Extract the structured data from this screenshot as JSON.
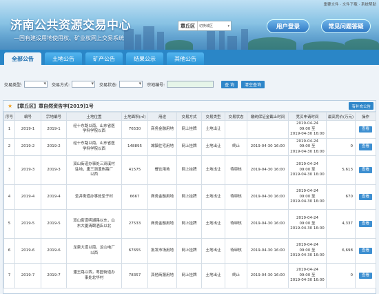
{
  "top_links": "重要文件 · 文件下载 · 系统帮助",
  "banner": {
    "title": "济南公共资源交易中心",
    "subtitle": "—国有建设用地使用权、矿业权网上交易系统",
    "region_label": "章丘区",
    "region_select": "切换城区",
    "login_label": "用户登录",
    "faq_label": "常见问题答疑"
  },
  "nav": {
    "tabs": [
      {
        "label": "全部公告",
        "active": true
      },
      {
        "label": "土地公告",
        "active": false
      },
      {
        "label": "矿产公告",
        "active": false
      },
      {
        "label": "结果公示",
        "active": false
      },
      {
        "label": "其他公告",
        "active": false
      }
    ]
  },
  "filter": {
    "type_label": "交易类型:",
    "method_label": "交易方式:",
    "status_label": "交易状态:",
    "parcel_label": "宗地编号:",
    "search_label": "查 询",
    "reset_label": "清空查询"
  },
  "panel": {
    "title": "【章丘区】章自然资告字[2019]1号",
    "supplement_label": "有补充公告"
  },
  "table": {
    "headers": [
      "序号",
      "编号",
      "宗地编号",
      "土地位置",
      "土地面积(㎡)",
      "用途",
      "交易方式",
      "交易类型",
      "交易状态",
      "缴纳保证金截止时间",
      "竞买申请时间",
      "最高竞价(万元)",
      "操作"
    ],
    "rows": [
      {
        "no": "1",
        "code": "2019-1",
        "parcel": "2019-1",
        "location": [
          "经十东路以南，山东省医",
          "学科学院以西"
        ],
        "area": "76530",
        "use": "商务金融用地",
        "method": "网上挂牌",
        "type": "土地出让",
        "status": "",
        "deadline": "",
        "apply": [
          "2019-04-24",
          "09:00 至",
          "2019-04-30 16:00"
        ],
        "price": "",
        "op": "查看"
      },
      {
        "no": "2",
        "code": "2019-2",
        "parcel": "2019-2",
        "location": [
          "经十东路以南，山东省医",
          "学科学院以西"
        ],
        "area": "148895",
        "use": "城镇住宅用地",
        "method": "网上挂牌",
        "type": "土地出让",
        "status": "终止",
        "deadline": "2019-04-30 16:00",
        "apply": [
          "2019-04-24",
          "09:00 至",
          "2019-04-30 16:00"
        ],
        "price": "0",
        "op": "查看"
      },
      {
        "no": "3",
        "code": "2019-3",
        "parcel": "2019-3",
        "location": [
          "双山街道办事处三涧溪村",
          "驻地，唐三涧溪热路厂",
          "以西"
        ],
        "area": "41575",
        "use": "餐饮用地",
        "method": "网上挂牌",
        "type": "土地出让",
        "status": "待审核",
        "deadline": "2019-04-30 16:00",
        "apply": [
          "2019-04-24",
          "09:00 至",
          "2019-04-30 16:00"
        ],
        "price": "5,613",
        "op": "查看"
      },
      {
        "no": "4",
        "code": "2019-4",
        "parcel": "2019-4",
        "location": [
          "圣井街道办事处圣子村"
        ],
        "area": "6667",
        "use": "商务金融用地",
        "method": "网上挂牌",
        "type": "土地出让",
        "status": "待审核",
        "deadline": "2019-04-30 16:00",
        "apply": [
          "2019-04-24",
          "09:00 至",
          "2019-04-30 16:00"
        ],
        "price": "670",
        "op": "查看"
      },
      {
        "no": "5",
        "code": "2019-5",
        "parcel": "2019-5",
        "location": [
          "双山街道明湖路以东，山",
          "东大厦清颐酒店以北"
        ],
        "area": "27533",
        "use": "商务金融用地",
        "method": "网上挂牌",
        "type": "土地出让",
        "status": "待审核",
        "deadline": "2019-04-30 16:00",
        "apply": [
          "2019-04-24",
          "09:00 至",
          "2019-04-30 16:00"
        ],
        "price": "4,337",
        "op": "查看"
      },
      {
        "no": "6",
        "code": "2019-6",
        "parcel": "2019-6",
        "location": [
          "龙泉大道以南，龙山电厂",
          "以西"
        ],
        "area": "67655",
        "use": "批发市场用地",
        "method": "网上挂牌",
        "type": "土地出让",
        "status": "待审核",
        "deadline": "2019-04-30 16:00",
        "apply": [
          "2019-04-24",
          "09:00 至",
          "2019-04-30 16:00"
        ],
        "price": "6,698",
        "op": "查看"
      },
      {
        "no": "7",
        "code": "2019-7",
        "parcel": "2019-7",
        "location": [
          "潘王路以西，枣园街道办",
          "事处北华村"
        ],
        "area": "78357",
        "use": "其他商服用地",
        "method": "网上挂牌",
        "type": "土地出让",
        "status": "终止",
        "deadline": "2019-04-30 16:00",
        "apply": [
          "2019-04-24",
          "09:00 至",
          "2019-04-30 16:00"
        ],
        "price": "0",
        "op": "查看"
      }
    ]
  }
}
